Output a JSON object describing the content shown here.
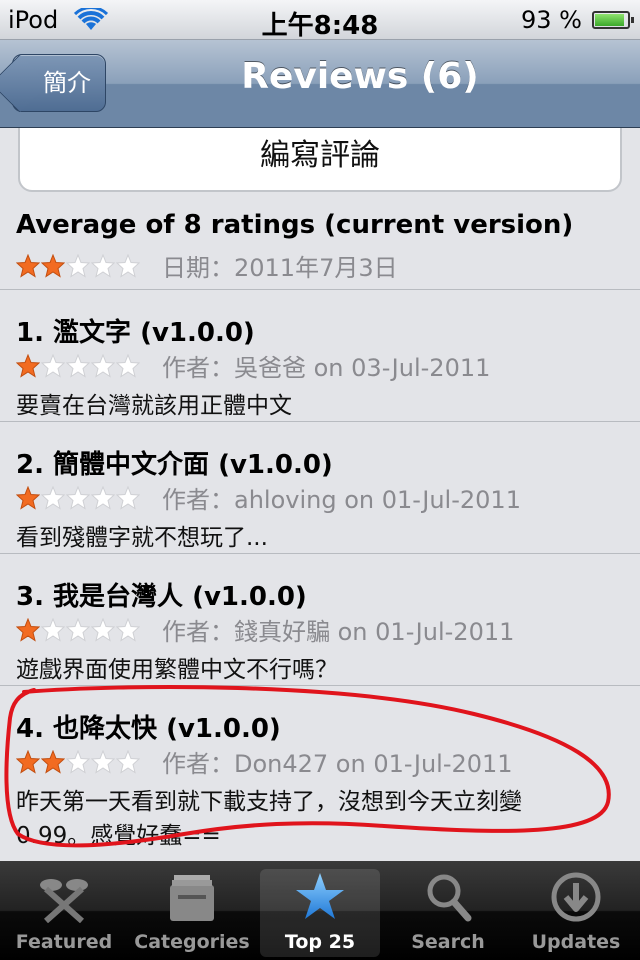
{
  "status_bar": {
    "carrier": "iPod",
    "time": "上午8:48",
    "battery_percent": "93 %",
    "battery_level": 0.93,
    "icons": [
      "wifi-icon",
      "battery-icon"
    ]
  },
  "nav_bar": {
    "back_label": "簡介",
    "title": "Reviews (6)"
  },
  "write_review_label": "編寫評論",
  "average": {
    "title": "Average of 8 ratings (current version)",
    "rating": 2,
    "date_text": "日期：2011年7月3日"
  },
  "reviews": [
    {
      "title": "1. 濫文字 (v1.0.0)",
      "rating": 1,
      "meta": "作者：吳爸爸 on 03-Jul-2011",
      "body": "要賣在台灣就該用正體中文"
    },
    {
      "title": "2. 簡體中文介面 (v1.0.0)",
      "rating": 1,
      "meta": "作者：ahloving on 01-Jul-2011",
      "body": "看到殘體字就不想玩了..."
    },
    {
      "title": "3. 我是台灣人 (v1.0.0)",
      "rating": 1,
      "meta": "作者：錢真好騙 on 01-Jul-2011",
      "body": "遊戲界面使用繁體中文不行嗎？"
    },
    {
      "title": "4. 也降太快 (v1.0.0)",
      "rating": 2,
      "meta": "作者：Don427 on 01-Jul-2011",
      "body_line1": "昨天第一天看到就下載支持了，沒想到今天立刻變",
      "body_line2": "0.99。感覺好蠢=="
    }
  ],
  "tab_bar": {
    "tabs": [
      {
        "label": "Featured",
        "icon": "featured-icon"
      },
      {
        "label": "Categories",
        "icon": "categories-icon"
      },
      {
        "label": "Top 25",
        "icon": "star-icon"
      },
      {
        "label": "Search",
        "icon": "search-icon"
      },
      {
        "label": "Updates",
        "icon": "updates-icon"
      }
    ],
    "active_index": 2
  },
  "colors": {
    "nav_bar": "#6d87a6",
    "star_filled": "#f26b21",
    "star_empty": "#ffffff",
    "annotation": "#e0141c"
  }
}
